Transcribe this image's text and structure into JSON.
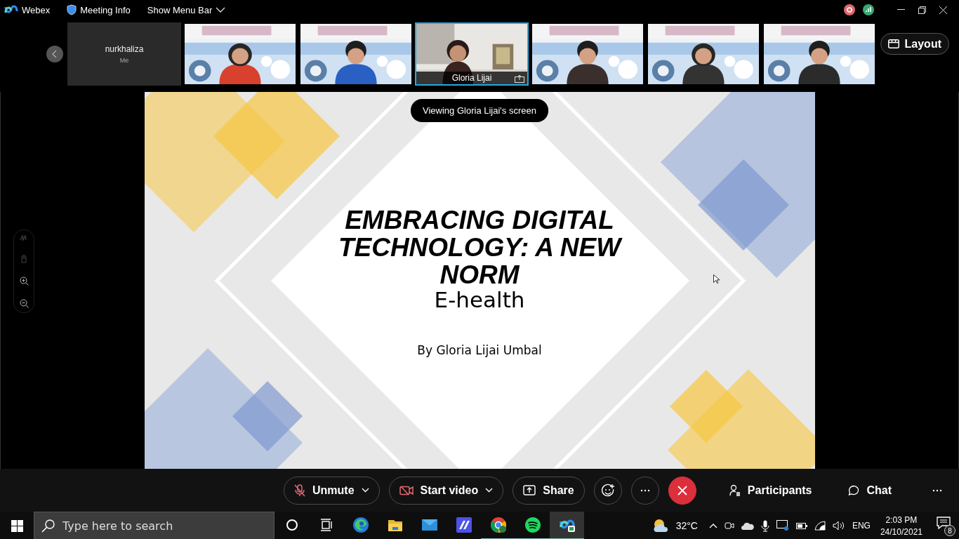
{
  "app_bar": {
    "app_name": "Webex",
    "meeting_info": "Meeting Info",
    "menu_toggle": "Show Menu Bar"
  },
  "participants": [
    {
      "kind": "self",
      "name": "nurkhaliza",
      "subtitle": "Me",
      "selected": false
    },
    {
      "kind": "video",
      "selected": false
    },
    {
      "kind": "video",
      "selected": false
    },
    {
      "kind": "room",
      "name": "Gloria Lijai",
      "selected": true,
      "sharing": true
    },
    {
      "kind": "video",
      "selected": false
    },
    {
      "kind": "video",
      "selected": false
    },
    {
      "kind": "video",
      "selected": false
    }
  ],
  "layout_button": "Layout",
  "share_banner": "Viewing Gloria Lijai's screen",
  "slide": {
    "title": "EMBRACING DIGITAL TECHNOLOGY: A NEW NORM",
    "subtitle": "E-health",
    "byline": "By Gloria Lijai Umbal"
  },
  "controls": [
    {
      "kind": "mute",
      "label": "Unmute",
      "dropdown": true
    },
    {
      "kind": "video",
      "label": "Start video",
      "dropdown": true
    },
    {
      "kind": "share",
      "label": "Share",
      "dropdown": false
    },
    {
      "kind": "reactions",
      "dropdown": false
    },
    {
      "kind": "more",
      "dropdown": false
    },
    {
      "kind": "leave",
      "dropdown": false
    }
  ],
  "panels": [
    {
      "kind": "participants",
      "label": "Participants"
    },
    {
      "kind": "chat",
      "label": "Chat"
    }
  ],
  "taskbar": {
    "search_placeholder": "Type here to search",
    "apps": [
      {
        "kind": "cortana",
        "running": false,
        "selected": false
      },
      {
        "kind": "taskview",
        "running": false,
        "selected": false
      },
      {
        "kind": "edge",
        "running": false,
        "selected": false
      },
      {
        "kind": "explorer",
        "running": false,
        "selected": false
      },
      {
        "kind": "mail",
        "running": false,
        "selected": false
      },
      {
        "kind": "editor",
        "running": false,
        "selected": false
      },
      {
        "kind": "chrome",
        "running": true,
        "selected": false
      },
      {
        "kind": "spotify",
        "running": true,
        "selected": false
      },
      {
        "kind": "webex",
        "running": true,
        "selected": true
      }
    ],
    "weather": "32°C",
    "language": "ENG",
    "time": "2:03 PM",
    "date": "24/10/2021",
    "notifications": "8"
  }
}
